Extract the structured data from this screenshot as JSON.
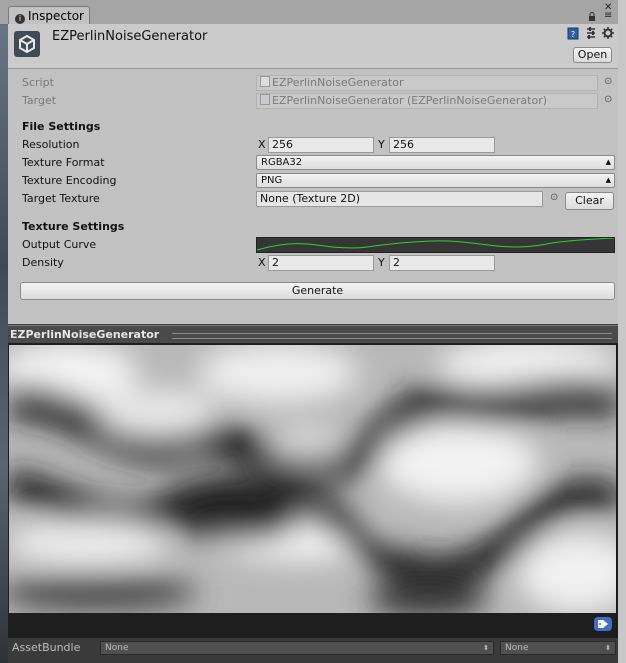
{
  "window": {
    "tab_label": "Inspector",
    "close_glyph": "✕",
    "menu_glyph": "≡"
  },
  "header": {
    "title": "EZPerlinNoiseGenerator",
    "open_button": "Open",
    "icons": [
      "help-book-icon",
      "preset-icon",
      "settings-gear-icon"
    ]
  },
  "fields": {
    "script": {
      "label": "Script",
      "value": "EZPerlinNoiseGenerator"
    },
    "target": {
      "label": "Target",
      "value": "EZPerlinNoiseGenerator (EZPerlinNoiseGenerator)"
    }
  },
  "file_settings": {
    "heading": "File Settings",
    "resolution": {
      "label": "Resolution",
      "x_label": "X",
      "x": "256",
      "y_label": "Y",
      "y": "256"
    },
    "texture_format": {
      "label": "Texture Format",
      "value": "RGBA32"
    },
    "texture_encoding": {
      "label": "Texture Encoding",
      "value": "PNG"
    },
    "target_texture": {
      "label": "Target Texture",
      "value": "None (Texture 2D)",
      "clear_button": "Clear"
    }
  },
  "texture_settings": {
    "heading": "Texture Settings",
    "output_curve": {
      "label": "Output Curve",
      "curve_color": "#2fd22f"
    },
    "density": {
      "label": "Density",
      "x_label": "X",
      "x": "2",
      "y_label": "Y",
      "y": "2"
    }
  },
  "generate_button": "Generate",
  "preview": {
    "title": "EZPerlinNoiseGenerator"
  },
  "asset_bundle": {
    "label": "AssetBundle",
    "name_value": "None",
    "variant_value": "None"
  }
}
